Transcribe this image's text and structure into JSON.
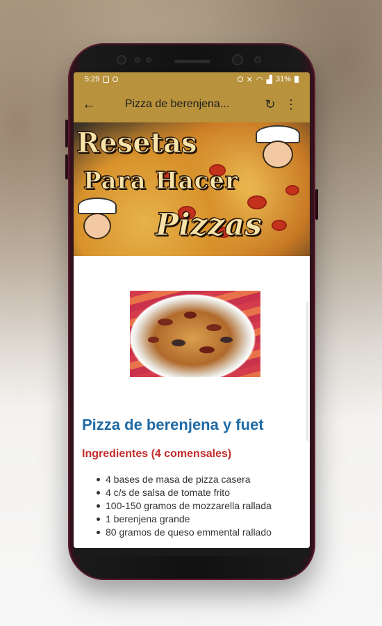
{
  "status_bar": {
    "time": "5:29",
    "battery": "31%",
    "icons": [
      "image-icon",
      "whatsapp-icon",
      "alarm-icon",
      "mute-icon",
      "wifi-icon",
      "signal-icon",
      "battery-icon"
    ]
  },
  "app_bar": {
    "back_icon": "arrow-left-icon",
    "title": "Pizza de berenjena...",
    "refresh_icon": "refresh-icon",
    "menu_icon": "more-vert-icon"
  },
  "banner": {
    "line1": "Resetas",
    "line2": "Para Hacer",
    "line3": "Pizzas"
  },
  "recipe": {
    "title": "Pizza de berenjena y fuet",
    "ingredients_heading": "Ingredientes (4 comensales)",
    "ingredients": [
      "4 bases de masa de pizza casera",
      "4 c/s de salsa de tomate frito",
      "100-150 gramos de mozzarella rallada",
      "1 berenjena grande",
      "80 gramos de queso emmental rallado"
    ]
  },
  "colors": {
    "app_bar": "#b8923c",
    "recipe_title": "#1f6aa5",
    "section_title": "#c42a2a"
  }
}
